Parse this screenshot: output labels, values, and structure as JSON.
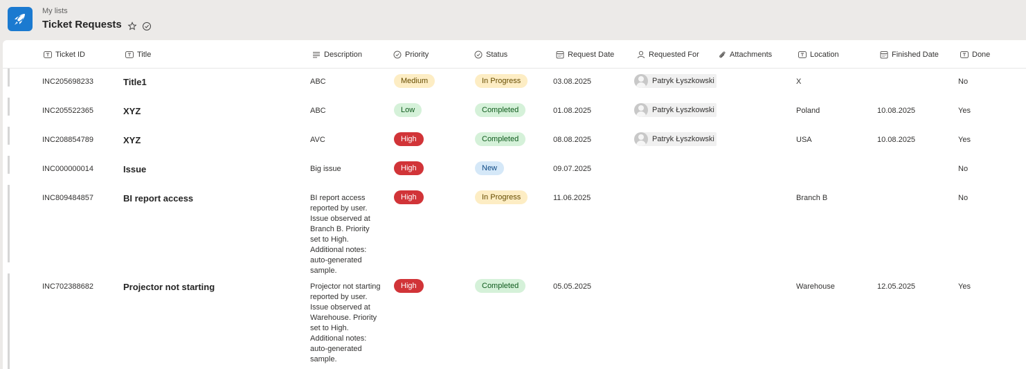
{
  "header": {
    "breadcrumb": "My lists",
    "title": "Ticket Requests",
    "app_icon": "rocket-icon",
    "favorite_icon": "star-icon",
    "following_icon": "circle-check-icon"
  },
  "columns": [
    {
      "key": "ticket_id",
      "label": "Ticket ID",
      "icon": "text-field-icon"
    },
    {
      "key": "title",
      "label": "Title",
      "icon": "text-field-icon"
    },
    {
      "key": "description",
      "label": "Description",
      "icon": "multiline-text-icon"
    },
    {
      "key": "priority",
      "label": "Priority",
      "icon": "choice-icon"
    },
    {
      "key": "status",
      "label": "Status",
      "icon": "choice-icon"
    },
    {
      "key": "request_date",
      "label": "Request Date",
      "icon": "calendar-icon"
    },
    {
      "key": "requested_for",
      "label": "Requested For",
      "icon": "person-icon"
    },
    {
      "key": "attachments",
      "label": "Attachments",
      "icon": "paperclip-icon"
    },
    {
      "key": "location",
      "label": "Location",
      "icon": "text-field-icon"
    },
    {
      "key": "finished_date",
      "label": "Finished Date",
      "icon": "calendar-icon"
    },
    {
      "key": "done",
      "label": "Done",
      "icon": "text-field-icon"
    }
  ],
  "status_colors": {
    "Medium": {
      "bg": "#fdedc4",
      "fg": "#664c00"
    },
    "Low": {
      "bg": "#d5f1d9",
      "fg": "#0e5a1c"
    },
    "High": {
      "bg": "#d13438",
      "fg": "#ffffff"
    },
    "In Progress": {
      "bg": "#fdedc4",
      "fg": "#664c00"
    },
    "Completed": {
      "bg": "#d5f1d9",
      "fg": "#0e5a1c"
    },
    "New": {
      "bg": "#d5e8f8",
      "fg": "#0f4a85"
    }
  },
  "rows": [
    {
      "ticket_id": "INC205698233",
      "title": "Title1",
      "description": "ABC",
      "priority": "Medium",
      "status": "In Progress",
      "request_date": "03.08.2025",
      "requested_for": "Patryk Łyszkowski",
      "location": "X",
      "finished_date": "",
      "done": "No"
    },
    {
      "ticket_id": "INC205522365",
      "title": "XYZ",
      "description": "ABC",
      "priority": "Low",
      "status": "Completed",
      "request_date": "01.08.2025",
      "requested_for": "Patryk Łyszkowski",
      "location": "Poland",
      "finished_date": "10.08.2025",
      "done": "Yes"
    },
    {
      "ticket_id": "INC208854789",
      "title": "XYZ",
      "description": "AVC",
      "priority": "High",
      "status": "Completed",
      "request_date": "08.08.2025",
      "requested_for": "Patryk Łyszkowski",
      "location": "USA",
      "finished_date": "10.08.2025",
      "done": "Yes"
    },
    {
      "ticket_id": "INC000000014",
      "title": "Issue",
      "description": "Big issue",
      "priority": "High",
      "status": "New",
      "request_date": "09.07.2025",
      "requested_for": "",
      "location": "",
      "finished_date": "",
      "done": "No"
    },
    {
      "ticket_id": "INC809484857",
      "title": "BI report access",
      "description": "BI report access reported by user. Issue observed at Branch B. Priority set to High. Additional notes: auto-generated sample.",
      "priority": "High",
      "status": "In Progress",
      "request_date": "11.06.2025",
      "requested_for": "",
      "location": "Branch B",
      "finished_date": "",
      "done": "No"
    },
    {
      "ticket_id": "INC702388682",
      "title": "Projector not starting",
      "description": "Projector not starting reported by user. Issue observed at Warehouse. Priority set to High. Additional notes: auto-generated sample.",
      "priority": "High",
      "status": "Completed",
      "request_date": "05.05.2025",
      "requested_for": "",
      "location": "Warehouse",
      "finished_date": "12.05.2025",
      "done": "Yes"
    }
  ]
}
